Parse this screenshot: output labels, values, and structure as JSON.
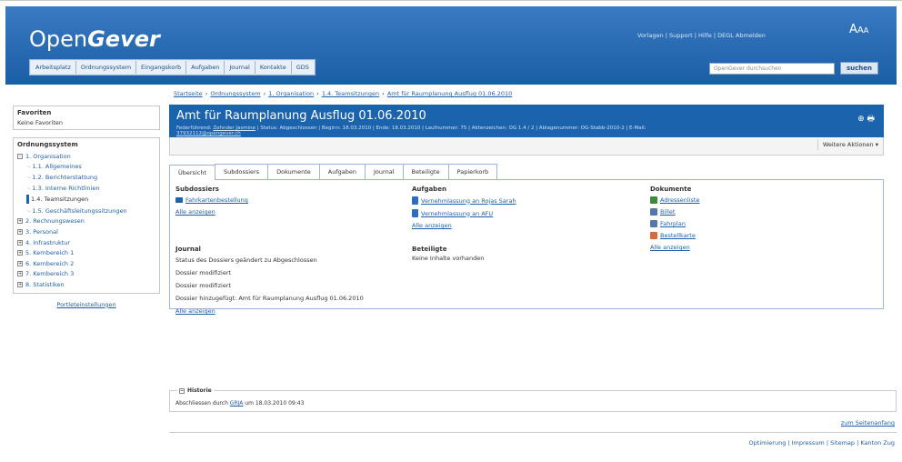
{
  "app": {
    "logo_main": "Open",
    "logo_bold": "Gever"
  },
  "toplinks": "Vorlagen | Support | Hilfe | DEGL Abmelden",
  "fontsize": {
    "a1": "A",
    "a2": "A",
    "a3": "A"
  },
  "nav": [
    "Arbeitsplatz",
    "Ordnungssystem",
    "Eingangskorb",
    "Aufgaben",
    "Journal",
    "Kontakte",
    "GDS"
  ],
  "search": {
    "placeholder": "OpenGever durchsuchen",
    "button": "suchen"
  },
  "breadcrumb": [
    "Startseite",
    "Ordnungssystem",
    "1. Organisation",
    "1.4. Teamsitzungen",
    "Amt für Raumplanung Ausflug 01.06.2010"
  ],
  "favorites": {
    "title": "Favoriten",
    "empty": "Keine Favoriten"
  },
  "ordnung": {
    "title": "Ordnungssystem",
    "items": [
      {
        "label": "1. Organisation",
        "level": 0,
        "sign": "-"
      },
      {
        "label": "1.1. Allgemeines",
        "level": 1
      },
      {
        "label": "1.2. Berichterstattung",
        "level": 1
      },
      {
        "label": "1.3. Interne Richtlinien",
        "level": 1
      },
      {
        "label": "1.4. Teamsitzungen",
        "level": 1,
        "active": true
      },
      {
        "label": "1.5. Geschäftsleitungssitzungen",
        "level": 1
      },
      {
        "label": "2. Rechnungswesen",
        "level": 0,
        "sign": "+"
      },
      {
        "label": "3. Personal",
        "level": 0,
        "sign": "+"
      },
      {
        "label": "4. Infrastruktur",
        "level": 0,
        "sign": "+"
      },
      {
        "label": "5. Kernbereich 1",
        "level": 0,
        "sign": "+"
      },
      {
        "label": "6. Kernbereich 2",
        "level": 0,
        "sign": "+"
      },
      {
        "label": "7. Kernbereich 3",
        "level": 0,
        "sign": "+"
      },
      {
        "label": "8. Statistiken",
        "level": 0,
        "sign": "+"
      }
    ]
  },
  "portlet": "Portleteinstellungen",
  "dossier": {
    "title": "Amt für Raumplanung Ausflug 01.06.2010",
    "meta_prefix": "Federführend: ",
    "meta_user": "Zehnder Jasmine",
    "meta_rest": " | Status: Abgeschlossen | Beginn: 18.03.2010 | Ende: 18.03.2010 | Laufnummer: 75 | Aktenzeichen: OG 1.4 / 2 | Ablagenummer: OG-Stabb-2010-2 | E-Mail:",
    "meta_email": "37932112@opengever.ch",
    "actions": "Weitere Aktionen ▾"
  },
  "tabs": [
    "Übersicht",
    "Subdossiers",
    "Dokumente",
    "Aufgaben",
    "Journal",
    "Beteiligte",
    "Papierkorb"
  ],
  "overview": {
    "subdossiers": {
      "title": "Subdossiers",
      "items": [
        "Fahrkartenbestellung"
      ],
      "more": "Alle anzeigen"
    },
    "aufgaben": {
      "title": "Aufgaben",
      "items": [
        "Vernehmlassung an Rojas Sarah",
        "Vernehmlassung an AFU"
      ],
      "more": "Alle anzeigen"
    },
    "dokumente": {
      "title": "Dokumente",
      "items": [
        {
          "label": "Adressenliste",
          "icon": "xls"
        },
        {
          "label": "Billet",
          "icon": "doc"
        },
        {
          "label": "Fahrplan",
          "icon": "doc"
        },
        {
          "label": "Bestellkarte",
          "icon": "pdf"
        }
      ],
      "more": "Alle anzeigen"
    },
    "journal": {
      "title": "Journal",
      "items": [
        "Status des Dossiers geändert zu Abgeschlossen",
        "Dossier modifiziert",
        "Dossier modifiziert",
        "Dossier hinzugefügt: Amt für Raumplanung Ausflug 01.06.2010"
      ],
      "more": "Alle anzeigen"
    },
    "beteiligte": {
      "title": "Beteiligte",
      "empty": "Keine Inhalte vorhanden"
    }
  },
  "historie": {
    "title": "Historie",
    "text_pre": "Abschliessen durch ",
    "user": "GRJA",
    "text_post": " um 18.03.2010 09:43"
  },
  "topanchor": "zum Seitenanfang",
  "footer": "Optimierung | Impressum | Sitemap | Kanton Zug"
}
